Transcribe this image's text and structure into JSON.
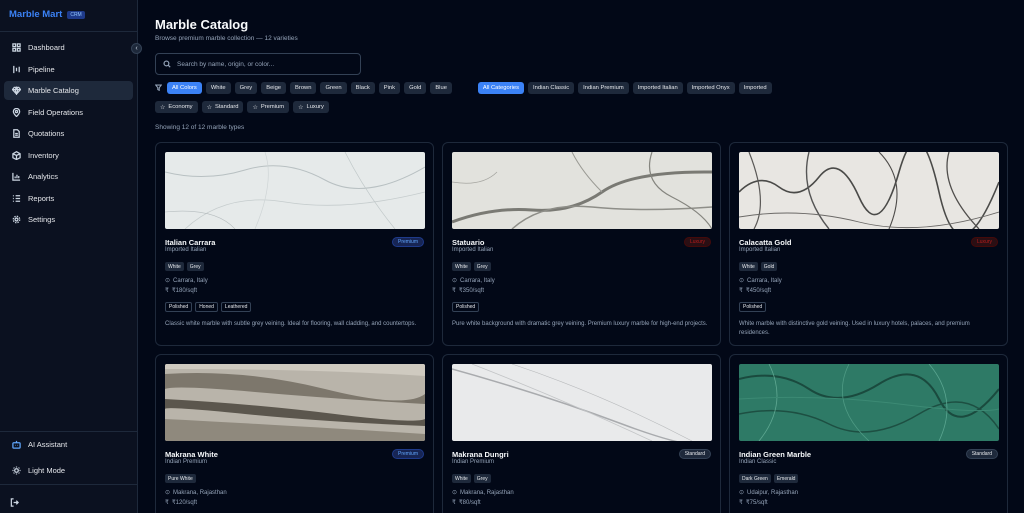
{
  "app": {
    "name": "Marble Mart",
    "badge": "CRM"
  },
  "nav": [
    {
      "label": "Dashboard",
      "icon": "grid-icon"
    },
    {
      "label": "Pipeline",
      "icon": "pipeline-icon"
    },
    {
      "label": "Marble Catalog",
      "icon": "gem-icon",
      "active": true
    },
    {
      "label": "Field Operations",
      "icon": "map-pin-icon"
    },
    {
      "label": "Quotations",
      "icon": "file-icon"
    },
    {
      "label": "Inventory",
      "icon": "box-icon"
    },
    {
      "label": "Analytics",
      "icon": "bar-chart-icon"
    },
    {
      "label": "Reports",
      "icon": "list-icon"
    },
    {
      "label": "Settings",
      "icon": "gear-icon"
    }
  ],
  "sidebar_bottom": {
    "ai": "AI Assistant",
    "light": "Light Mode"
  },
  "page": {
    "title": "Marble Catalog",
    "subtitle": "Browse premium marble collection — 12 varieties",
    "search_placeholder": "Search by name, origin, or color...",
    "showing": "Showing 12 of 12 marble types"
  },
  "colors": [
    "All Colors",
    "White",
    "Grey",
    "Beige",
    "Brown",
    "Green",
    "Black",
    "Pink",
    "Gold",
    "Blue"
  ],
  "categories": [
    "All Categories",
    "Indian Classic",
    "Indian Premium",
    "Imported Italian",
    "Imported Onyx",
    "Imported"
  ],
  "tiers": [
    "Economy",
    "Standard",
    "Premium",
    "Luxury"
  ],
  "cards": [
    {
      "name": "Italian Carrara",
      "category": "Imported Italian",
      "tier": "Premium",
      "tags": [
        "White",
        "Grey"
      ],
      "origin": "Carrara, Italy",
      "price": "₹180/sqft",
      "finishes": [
        "Polished",
        "Honed",
        "Leathered"
      ],
      "desc": "Classic white marble with subtle grey veining. Ideal for flooring, wall cladding, and countertops."
    },
    {
      "name": "Statuario",
      "category": "Imported Italian",
      "tier": "Luxury",
      "tags": [
        "White",
        "Grey"
      ],
      "origin": "Carrara, Italy",
      "price": "₹350/sqft",
      "finishes": [
        "Polished"
      ],
      "desc": "Pure white background with dramatic grey veining. Premium luxury marble for high-end projects."
    },
    {
      "name": "Calacatta Gold",
      "category": "Imported Italian",
      "tier": "Luxury",
      "tags": [
        "White",
        "Gold"
      ],
      "origin": "Carrara, Italy",
      "price": "₹450/sqft",
      "finishes": [
        "Polished"
      ],
      "desc": "White marble with distinctive gold veining. Used in luxury hotels, palaces, and premium residences."
    },
    {
      "name": "Makrana White",
      "category": "Indian Premium",
      "tier": "Premium",
      "tags": [
        "Pure White"
      ],
      "origin": "Makrana, Rajasthan",
      "price": "₹120/sqft",
      "finishes": [],
      "desc": ""
    },
    {
      "name": "Makrana Dungri",
      "category": "Indian Premium",
      "tier": "Standard",
      "tags": [
        "White",
        "Grey"
      ],
      "origin": "Makrana, Rajasthan",
      "price": "₹80/sqft",
      "finishes": [],
      "desc": ""
    },
    {
      "name": "Indian Green Marble",
      "category": "Indian Classic",
      "tier": "Standard",
      "tags": [
        "Dark Green",
        "Emerald"
      ],
      "origin": "Udaipur, Rajasthan",
      "price": "₹75/sqft",
      "finishes": [],
      "desc": ""
    }
  ]
}
